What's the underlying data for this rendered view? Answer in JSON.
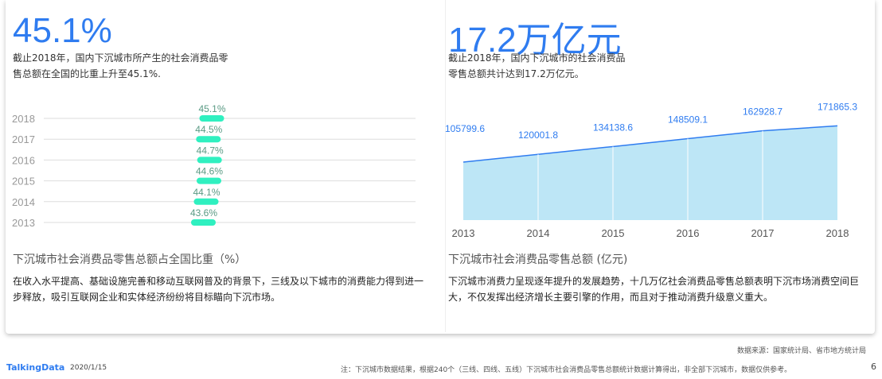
{
  "left": {
    "big": "45.1%",
    "desc": "截止2018年，国内下沉城市所产生的社会消费品零售总额在全国的比重上升至45.1%.",
    "chart_title": "下沉城市社会消费品零售总额占全国比重（%）",
    "para": "在收入水平提高、基础设施完善和移动互联网普及的背景下，三线及以下城市的消费能力得到进一步释放，吸引互联网企业和实体经济纷纷将目标瞄向下沉市场。"
  },
  "right": {
    "big": "17.2万亿元",
    "desc": "截止2018年，国内下沉城市的社会消费品零售总额共计达到17.2万亿元。",
    "chart_title": "下沉城市社会消费品零售总额 (亿元)",
    "para": "下沉城市消费力呈现逐年提升的发展趋势，十几万亿社会消费品零售总额表明下沉市场消费空间巨大，不仅发挥出经济增长主要引擎的作用，而且对于推动消费升级意义重大。"
  },
  "footer": {
    "source": "数据来源：国家统计局、省市地方统计局",
    "logo": "TalkingData",
    "date": "2020/1/15",
    "note": "注：下沉城市数据结果，根据240个（三线、四线、五线）下沉城市社会消费品零售总额统计数据计算得出，非全部下沉城市，数据仅供参考。",
    "page": "6"
  },
  "chart_data": [
    {
      "type": "bar",
      "title": "下沉城市社会消费品零售总额占全国比重（%）",
      "categories": [
        "2018",
        "2017",
        "2016",
        "2015",
        "2014",
        "2013"
      ],
      "values": [
        45.1,
        44.5,
        44.7,
        44.6,
        44.1,
        43.6
      ],
      "labels": [
        "45.1%",
        "44.5%",
        "44.7%",
        "44.6%",
        "44.1%",
        "43.6%"
      ],
      "color": "#2ff0c0"
    },
    {
      "type": "area",
      "title": "下沉城市社会消费品零售总额 (亿元)",
      "categories": [
        "2013",
        "2014",
        "2015",
        "2016",
        "2017",
        "2018"
      ],
      "values": [
        105799.6,
        120001.8,
        134138.6,
        148509.1,
        162928.7,
        171865.3
      ],
      "ylim": [
        0,
        200000
      ],
      "fill": "#bde6f6",
      "line": "#2f7cf0"
    }
  ]
}
